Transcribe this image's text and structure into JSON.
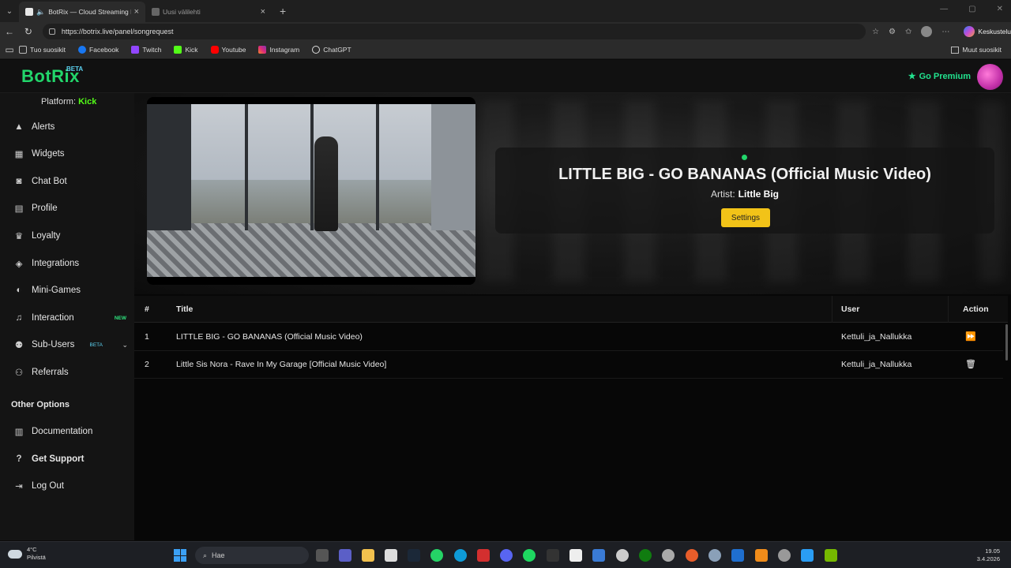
{
  "browser": {
    "tabs": [
      {
        "title": "BotRix — Cloud Streaming Bot"
      },
      {
        "title": "Uusi välilehti"
      }
    ],
    "url": "https://botrix.live/panel/songrequest",
    "copilot_label": "Keskustelu",
    "bookmarks": [
      "Tuo suosikit",
      "Facebook",
      "Twitch",
      "Kick",
      "Youtube",
      "Instagram",
      "ChatGPT"
    ],
    "other_favorites": "Muut suosikit"
  },
  "header": {
    "logo": "BotRix",
    "logo_badge": "BETA",
    "premium_label": "Go Premium",
    "accent": "#22d66b"
  },
  "sidebar": {
    "platform_label": "Platform:",
    "platform_value": "Kick",
    "items": [
      {
        "label": "Alerts",
        "icon": "warning-icon"
      },
      {
        "label": "Widgets",
        "icon": "grid-icon"
      },
      {
        "label": "Chat Bot",
        "icon": "robot-icon"
      },
      {
        "label": "Profile",
        "icon": "id-card-icon"
      },
      {
        "label": "Loyalty",
        "icon": "trophy-icon"
      },
      {
        "label": "Integrations",
        "icon": "cube-icon"
      },
      {
        "label": "Mini-Games",
        "icon": "gamepad-icon"
      },
      {
        "label": "Interaction",
        "icon": "music-icon",
        "badge": "NEW"
      },
      {
        "label": "Sub-Users",
        "icon": "users-icon",
        "badge": "BETA"
      },
      {
        "label": "Referrals",
        "icon": "people-icon"
      }
    ],
    "other_title": "Other Options",
    "other_items": [
      {
        "label": "Documentation",
        "icon": "docs-icon"
      },
      {
        "label": "Get Support",
        "icon": "question-icon"
      },
      {
        "label": "Log Out",
        "icon": "logout-icon"
      }
    ]
  },
  "now_playing": {
    "title": "LITTLE BIG - GO BANANAS (Official Music Video)",
    "artist_label": "Artist:",
    "artist": "Little Big",
    "settings_label": "Settings"
  },
  "queue": {
    "headers": {
      "num": "#",
      "title": "Title",
      "user": "User",
      "action": "Action"
    },
    "rows": [
      {
        "num": "1",
        "title": "LITTLE BIG - GO BANANAS (Official Music Video)",
        "user": "Kettuli_ja_Nallukka",
        "action": "skip-icon"
      },
      {
        "num": "2",
        "title": "Little Sis Nora - Rave In My Garage [Official Music Video]",
        "user": "Kettuli_ja_Nallukka",
        "action": "trash-icon"
      }
    ]
  },
  "taskbar": {
    "temp": "4°C",
    "weather": "Pilvistä",
    "search_placeholder": "Hae",
    "time": "19.05",
    "date": "3.4.2026"
  }
}
